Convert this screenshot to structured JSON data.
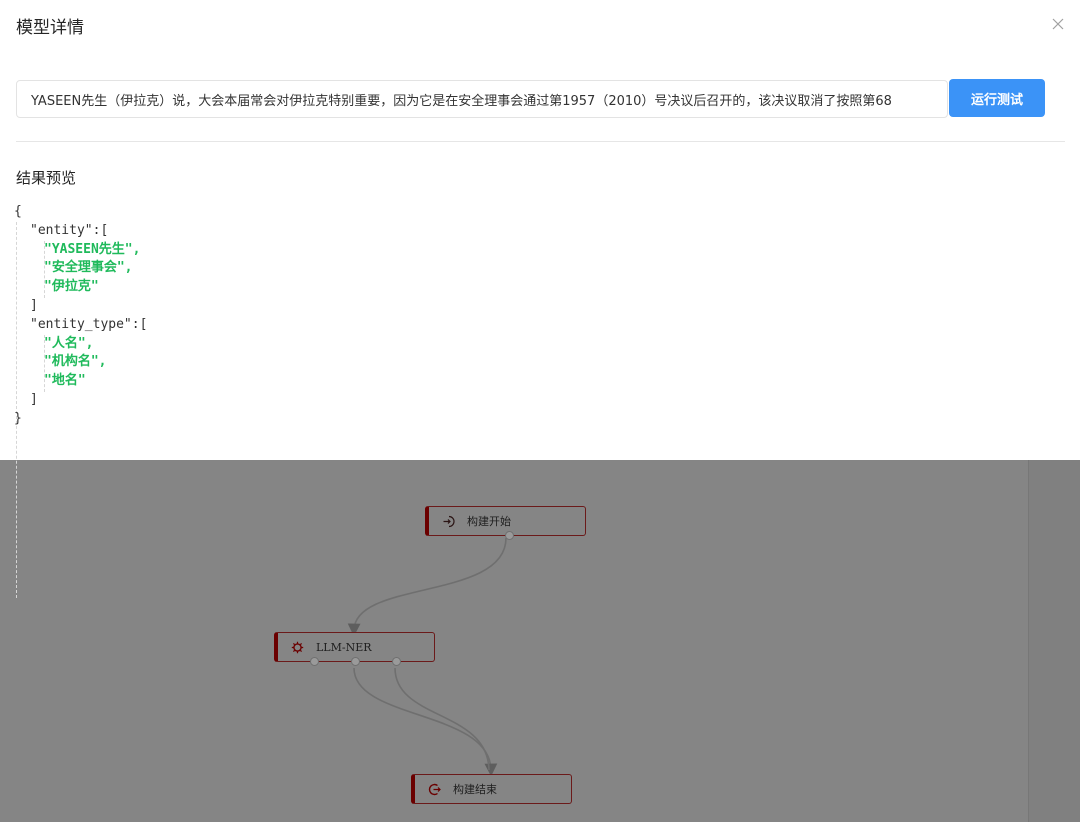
{
  "modal": {
    "title": "模型详情",
    "input_value": "YASEEN先生（伊拉克）说，大会本届常会对伊拉克特别重要，因为它是在安全理事会通过第1957（2010）号决议后召开的，该决议取消了按照第68",
    "run_button": "运行测试",
    "result_title": "结果预览",
    "json_preview": {
      "open": "{",
      "entity_key": "\"entity\":[",
      "entity_values": [
        "\"YASEEN先生\",",
        "\"安全理事会\",",
        "\"伊拉克\""
      ],
      "entity_close": "]",
      "entity_type_key": "\"entity_type\":[",
      "entity_type_values": [
        "\"人名\",",
        "\"机构名\",",
        "\"地名\""
      ],
      "entity_type_close": "]",
      "close": "}"
    }
  },
  "canvas": {
    "nodes": [
      {
        "label": "构建开始",
        "icon": "login-icon"
      },
      {
        "label": "LLM-NER",
        "icon": "gear-icon"
      },
      {
        "label": "构建结束",
        "icon": "logout-icon"
      }
    ]
  },
  "colors": {
    "primary": "#3b93f7",
    "json_string": "#1fba5b",
    "node_border": "#6b0000",
    "overlay": "#858585"
  }
}
